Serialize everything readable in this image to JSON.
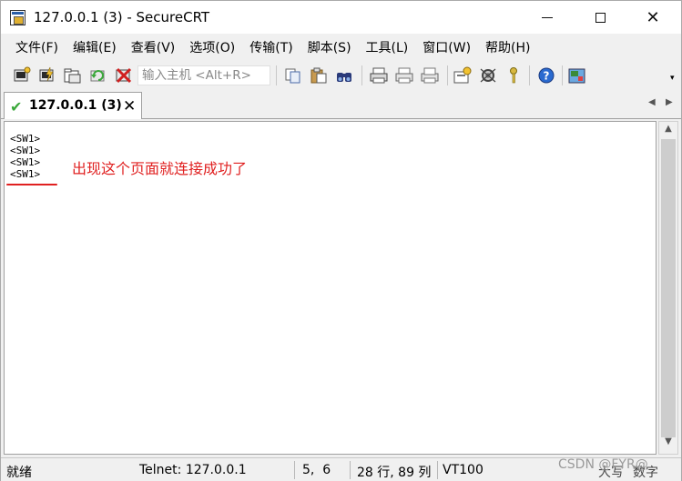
{
  "window": {
    "title": "127.0.0.1 (3) - SecureCRT",
    "close_glyph": "✕"
  },
  "menu": [
    "文件(F)",
    "编辑(E)",
    "查看(V)",
    "选项(O)",
    "传输(T)",
    "脚本(S)",
    "工具(L)",
    "窗口(W)",
    "帮助(H)"
  ],
  "toolbar": {
    "host_placeholder": "输入主机 <Alt+R>",
    "icons_left": [
      "connect-icon",
      "quick-connect-icon",
      "connect-in-tab-icon",
      "reconnect-icon",
      "disconnect-icon"
    ],
    "icons_right": [
      "copy-icon",
      "paste-icon",
      "find-icon",
      "print-icon",
      "print-selection-icon",
      "print-screen-icon",
      "session-options-icon",
      "global-options-icon",
      "keymap-icon",
      "help-icon",
      "sftp-icon"
    ]
  },
  "tab": {
    "label": "127.0.0.1 (3)",
    "check_glyph": "✔",
    "close_glyph": "✕",
    "nav_left": "◀",
    "nav_right": "▶"
  },
  "terminal": {
    "lines": [
      "<SW1>",
      "<SW1>",
      "<SW1>",
      "<SW1>"
    ],
    "annotation": "出现这个页面就连接成功了"
  },
  "scrollbar": {
    "up": "▲",
    "down": "▼"
  },
  "status": {
    "ready": "就绪",
    "connection": "Telnet: 127.0.0.1",
    "cursor": "5,  6",
    "size": "28 行, 89 列",
    "emulation": "VT100",
    "caps": "大写",
    "num": "数字"
  },
  "watermark": "CSDN @FYR@"
}
